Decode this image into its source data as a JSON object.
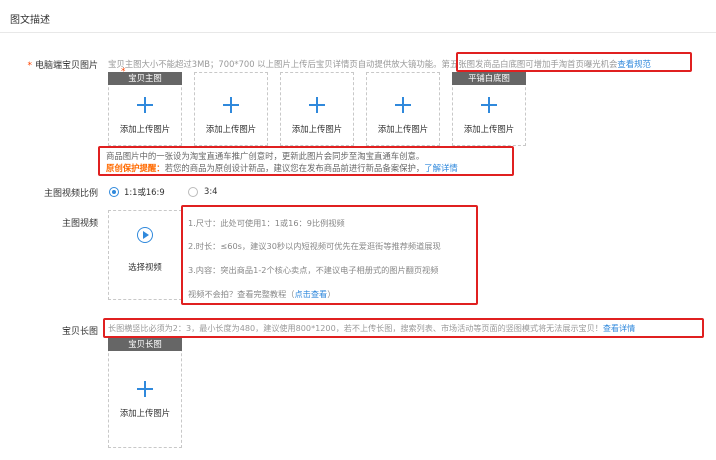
{
  "section": {
    "title": "图文描述"
  },
  "pc_images": {
    "label": "电脑端宝贝图片",
    "required_mark": "*",
    "hint_prefix": "宝贝主图大小不能超过3MB；700*700 以上图片上传后宝贝详情页自动提供放大镜功能。",
    "hint_highlight": "第五张图发商品白底图可增加手淘首页曝光机会",
    "hint_link": "查看规范",
    "slots": [
      {
        "tag": "宝贝主图",
        "required": "*",
        "text": "添加上传图片"
      },
      {
        "tag": "",
        "text": "添加上传图片"
      },
      {
        "tag": "",
        "text": "添加上传图片"
      },
      {
        "tag": "",
        "text": "添加上传图片"
      },
      {
        "tag": "平铺白底图",
        "text": "添加上传图片"
      }
    ],
    "warn_line1": "商品图片中的一张设为淘宝直通车推广创意时，更新此图片会同步至淘宝直通车创意。",
    "warn_strong": "原创保护提醒：",
    "warn_line2": "若您的商品为原创设计新品，建议您在发布商品前进行新品备案保护，",
    "warn_link": "了解详情"
  },
  "video_ratio": {
    "label": "主图视频比例",
    "options": [
      {
        "label": "1:1或16:9",
        "selected": true
      },
      {
        "label": "3:4",
        "selected": false
      }
    ]
  },
  "main_video": {
    "label": "主图视频",
    "upload_text": "选择视频",
    "notes": [
      "1.尺寸：此处可使用1：1或16：9比例视频",
      "2.时长：≤60s，建议30秒以内短视频可优先在爱逛街等推荐频道展现",
      "3.内容：突出商品1-2个核心卖点，不建议电子相册式的图片翻页视频"
    ],
    "help_prefix": "视频不会拍？查看完整教程（",
    "help_link": "点击查看",
    "help_suffix": "）"
  },
  "long_image": {
    "label": "宝贝长图",
    "hint": "长图横竖比必须为2：3，最小长度为480，建议使用800*1200，若不上传长图，搜索列表、市场活动等页面的竖图模式将无法展示宝贝！",
    "hint_link": "查看详情",
    "slot_tag": "宝贝长图",
    "slot_text": "添加上传图片"
  },
  "colors": {
    "accent": "#3089dc",
    "highlight": "#e02020",
    "warning": "#ff6a00",
    "required": "#ff4400"
  }
}
